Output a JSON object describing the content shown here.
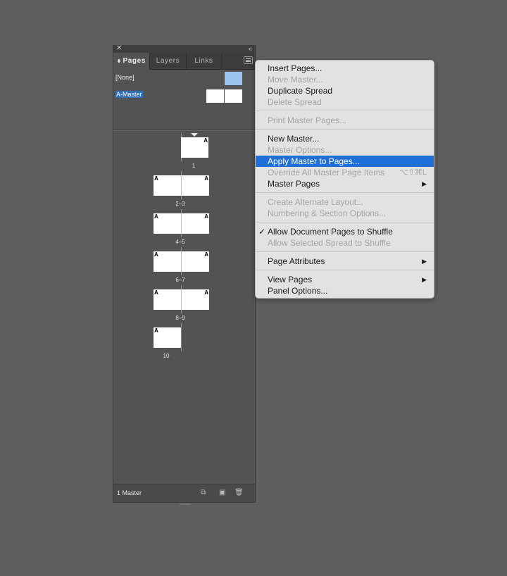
{
  "panel": {
    "tabs": [
      {
        "label": "Pages",
        "active": true
      },
      {
        "label": "Layers",
        "active": false
      },
      {
        "label": "Links",
        "active": false
      }
    ],
    "masters": [
      {
        "label": "[None]"
      },
      {
        "label": "A-Master"
      }
    ],
    "page_prefix": "A",
    "page_groups": [
      "1",
      "2–3",
      "4–5",
      "6–7",
      "8–9",
      "10"
    ],
    "footer": {
      "label": "1 Master"
    }
  },
  "menu": {
    "items": [
      {
        "label": "Insert Pages...",
        "enabled": true
      },
      {
        "label": "Move Master...",
        "enabled": false
      },
      {
        "label": "Duplicate Spread",
        "enabled": true
      },
      {
        "label": "Delete Spread",
        "enabled": false
      },
      {
        "label": "Print Master Pages...",
        "enabled": false
      },
      {
        "label": "New Master...",
        "enabled": true
      },
      {
        "label": "Master Options...",
        "enabled": false
      },
      {
        "label": "Apply Master to Pages...",
        "enabled": true,
        "highlighted": true
      },
      {
        "label": "Override All Master Page Items",
        "enabled": false,
        "shortcut": "⌥⇧⌘L"
      },
      {
        "label": "Master Pages",
        "enabled": true,
        "submenu": true
      },
      {
        "label": "Create Alternate Layout...",
        "enabled": false
      },
      {
        "label": "Numbering & Section Options...",
        "enabled": false
      },
      {
        "label": "Allow Document Pages to Shuffle",
        "enabled": true,
        "checked": true
      },
      {
        "label": "Allow Selected Spread to Shuffle",
        "enabled": false
      },
      {
        "label": "Page Attributes",
        "enabled": true,
        "submenu": true
      },
      {
        "label": "View Pages",
        "enabled": true,
        "submenu": true
      },
      {
        "label": "Panel Options...",
        "enabled": true
      }
    ]
  },
  "colors": {
    "highlight": "#1f6fd8",
    "selection": "#2f6fb7",
    "none_master_thumb": "#9cc3ef"
  }
}
